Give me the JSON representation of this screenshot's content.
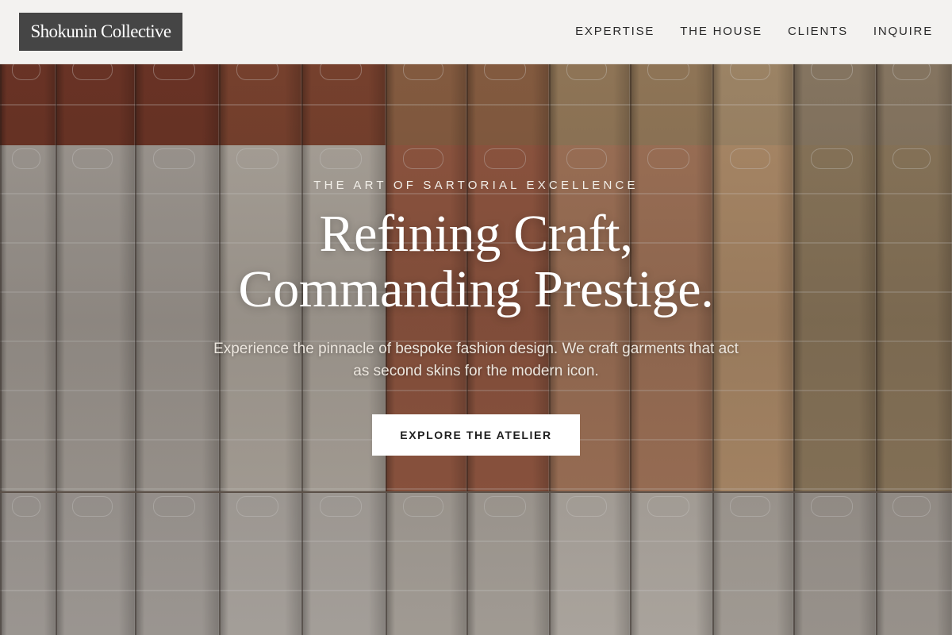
{
  "header": {
    "logo_text": "Shokunin Collective",
    "nav": [
      {
        "label": "EXPERTISE"
      },
      {
        "label": "THE HOUSE"
      },
      {
        "label": "CLIENTS"
      },
      {
        "label": "INQUIRE"
      }
    ]
  },
  "hero": {
    "eyebrow": "THE ART OF SARTORIAL EXCELLENCE",
    "headline_line1": "Refining Craft,",
    "headline_line2": "Commanding Prestige.",
    "subtitle": "Experience the pinnacle of bespoke fashion design. We craft garments that act as second skins for the modern icon.",
    "cta_label": "EXPLORE THE ATELIER",
    "background_description_colors": {
      "top_row": [
        "#7a3a2a",
        "#8a4a34",
        "#9a6a4a",
        "#a88a66",
        "#b89c78",
        "#9c8a72"
      ],
      "middle_row": [
        "#b9b3ac",
        "#c7c0b6",
        "#a7634a",
        "#b98566",
        "#c9a27a",
        "#a08a6a"
      ],
      "bottom_row": [
        "#b7b2ad",
        "#c2bdb7",
        "#beb8b0",
        "#c9c3bb",
        "#bdb7af",
        "#b3ada6"
      ]
    }
  }
}
